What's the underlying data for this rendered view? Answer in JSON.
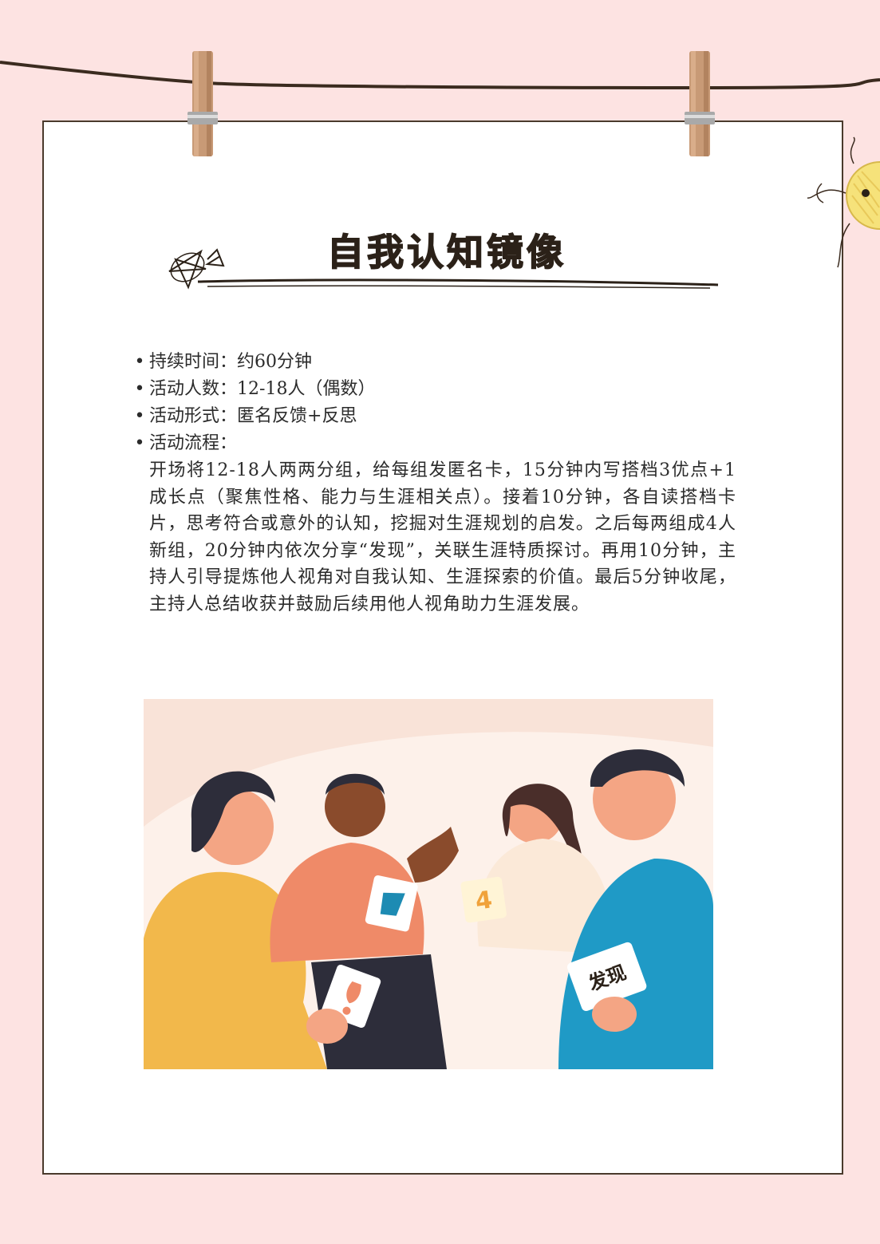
{
  "page": {
    "title": "自我认知镜像",
    "info": [
      {
        "label": "持续时间：",
        "value": "约60分钟"
      },
      {
        "label": "活动人数：",
        "value": "12-18人（偶数）"
      },
      {
        "label": "活动形式：",
        "value": "匿名反馈+反思"
      },
      {
        "label": "活动流程：",
        "value": ""
      }
    ],
    "process": "开场将12-18人两两分组，给每组发匿名卡，15分钟内写搭档3优点+1成长点（聚焦性格、能力与生涯相关点）。接着10分钟，各自读搭档卡片，思考符合或意外的认知，挖掘对生涯规划的启发。之后每两组成4人新组，20分钟内依次分享“发现”，关联生涯特质探讨。再用10分钟，主持人引导提炼他人视角对自我认知、生涯探索的价值。最后5分钟收尾，主持人总结收获并鼓励后续用他人视角助力生涯发展。",
    "illustration": {
      "card_number": "4",
      "card_text": "发现"
    }
  },
  "colors": {
    "background": "#fde3e2",
    "frame": "#4a3a2c",
    "title": "#2b2118"
  }
}
